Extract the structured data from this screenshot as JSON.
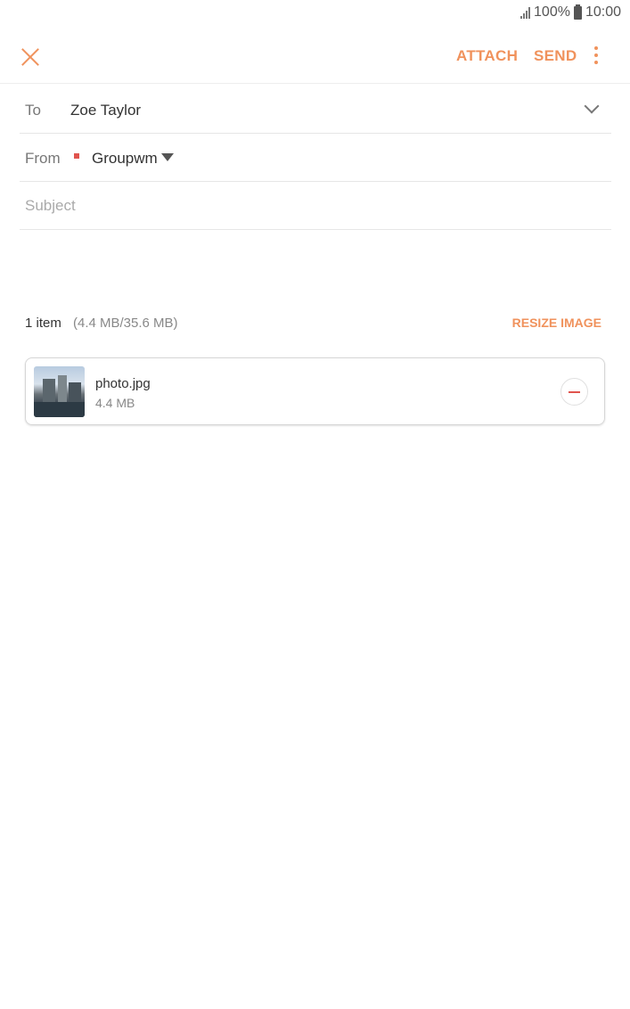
{
  "status_bar": {
    "battery": "100%",
    "time": "10:00"
  },
  "toolbar": {
    "attach_label": "ATTACH",
    "send_label": "SEND"
  },
  "to": {
    "label": "To",
    "value": "Zoe Taylor"
  },
  "from": {
    "label": "From",
    "value": "Groupwm"
  },
  "subject": {
    "placeholder": "Subject",
    "value": ""
  },
  "attachments": {
    "count_label": "1 item",
    "size_label": "(4.4 MB/35.6 MB)",
    "resize_label": "RESIZE IMAGE",
    "items": [
      {
        "name": "photo.jpg",
        "size": "4.4 MB"
      }
    ]
  },
  "colors": {
    "accent": "#f0925c",
    "remove": "#e0544e"
  },
  "icons": [
    "close-icon",
    "more-vert-icon",
    "chevron-down-icon",
    "dropdown-caret-icon",
    "remove-icon",
    "signal-icon",
    "battery-icon"
  ]
}
